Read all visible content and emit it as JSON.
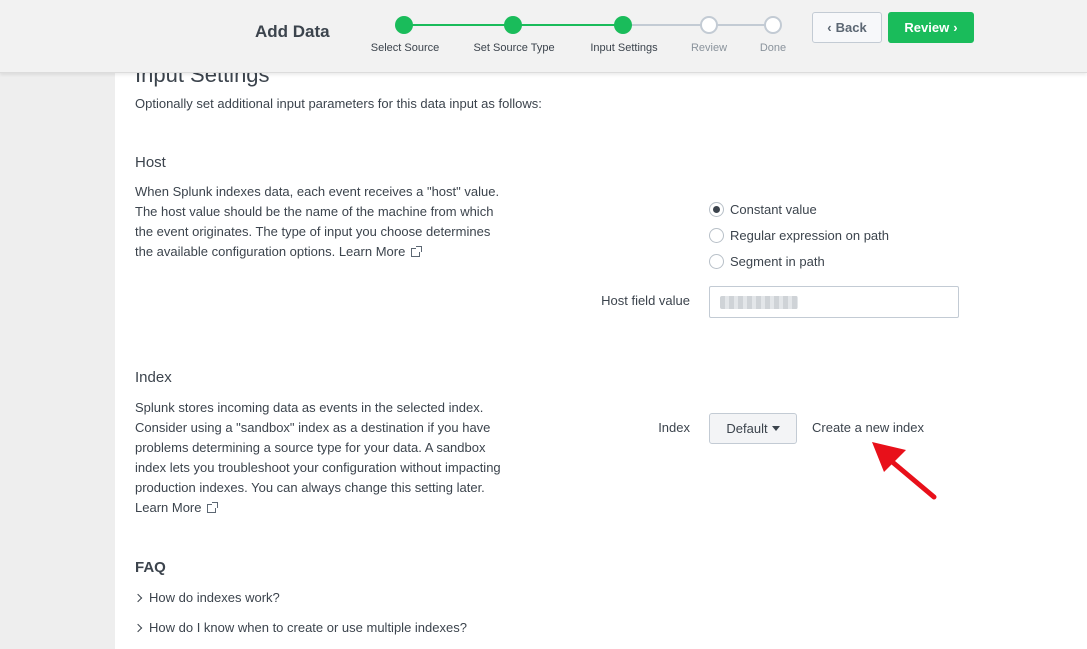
{
  "header": {
    "title": "Add Data",
    "steps": [
      {
        "label": "Select Source",
        "state": "done"
      },
      {
        "label": "Set Source Type",
        "state": "done"
      },
      {
        "label": "Input Settings",
        "state": "done"
      },
      {
        "label": "Review",
        "state": "todo"
      },
      {
        "label": "Done",
        "state": "todo"
      }
    ],
    "back_label": "Back",
    "review_label": "Review",
    "accent_color": "#1abc5b"
  },
  "page": {
    "heading": "Input Settings",
    "intro": "Optionally set additional input parameters for this data input as follows:"
  },
  "host": {
    "title": "Host",
    "lines": [
      "When Splunk indexes data, each event receives a \"host\" value.",
      "The host value should be the name of the machine from which",
      "the event originates. The type of input you choose determines",
      "the available configuration options."
    ],
    "learn_more": "Learn More",
    "options": [
      {
        "label": "Constant value",
        "checked": true
      },
      {
        "label": "Regular expression on path",
        "checked": false
      },
      {
        "label": "Segment in path",
        "checked": false
      }
    ],
    "field_label": "Host field value"
  },
  "index": {
    "title": "Index",
    "lines": [
      "Splunk stores incoming data as events in the selected index.",
      "Consider using a \"sandbox\" index as a destination if you have",
      "problems determining a source type for your data. A sandbox",
      "index lets you troubleshoot your configuration without impacting",
      "production indexes. You can always change this setting later."
    ],
    "learn_more": "Learn More",
    "field_label": "Index",
    "selected": "Default",
    "create_link": "Create a new index"
  },
  "faq": {
    "title": "FAQ",
    "items": [
      "How do indexes work?",
      "How do I know when to create or use multiple indexes?"
    ]
  },
  "annotation": {
    "arrow_color": "#e8101a"
  }
}
